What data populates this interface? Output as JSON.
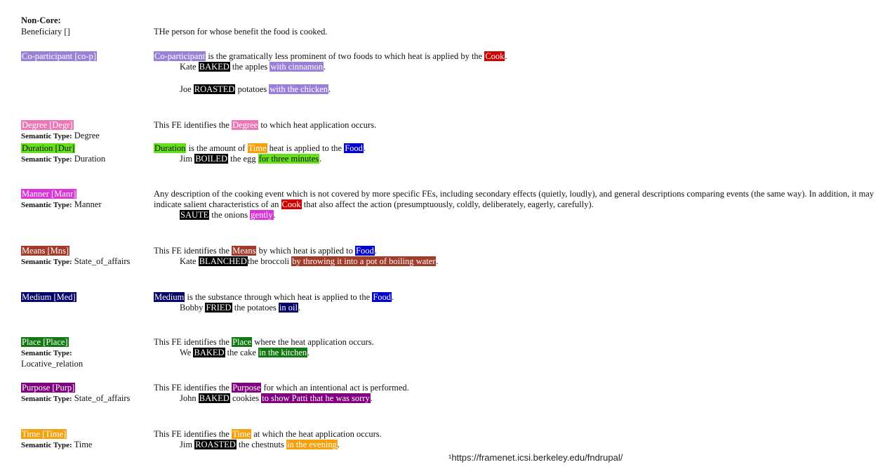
{
  "section_header": "Non-Core:",
  "beneficiary": {
    "name": "Beneficiary []",
    "def": "THe person for whose benefit the food is cooked."
  },
  "semantic_type_label": "Semantic Type:",
  "coparticipant": {
    "name": "Co-participant [co-p]",
    "fe": "Co-participant",
    "def_mid": " is the gramatically less prominent of two foods to which heat is applied by the ",
    "cook": "Cook",
    "end": ".",
    "ex1": {
      "pre": "Kate ",
      "target": "BAKED",
      "mid": " the apples ",
      "fe": "with cinnamon",
      "post": "."
    },
    "ex2": {
      "pre": "Joe ",
      "target": "ROASTED",
      "mid": " potatoes ",
      "fe": "with the chicken",
      "post": "."
    }
  },
  "degree": {
    "name": "Degree [Degr]",
    "type": "Degree",
    "def_pre": "This FE identifies the ",
    "fe": "Degree",
    "def_post": " to which heat application occurs."
  },
  "duration": {
    "name": "Duration [Dur]",
    "type": "Duration",
    "fe": "Duration",
    "def_mid": " is the amount of ",
    "time": "Time",
    "def_mid2": " heat is applied to the ",
    "food": "Food",
    "end": ".",
    "ex": {
      "pre": "Jim ",
      "target": "BOILED",
      "mid": " the egg ",
      "fe": "for three minutes",
      "post": "."
    }
  },
  "manner": {
    "name": "Manner [Manr]",
    "type": "Manner",
    "def_pre": "Any description of the cooking event which is not covered by more specific FEs, including secondary effects (quietly, loudly), and general descriptions comparing events (the same way). In addition, it may indicate salient characteristics of an ",
    "cook": "Cook",
    "def_post": " that also affect the action (presumptuously, coldly, deliberately, eagerly, carefully).",
    "ex": {
      "target": "SAUTE",
      "mid": " the onions ",
      "fe": "gently",
      "post": "."
    }
  },
  "means": {
    "name": "Means [Mns]",
    "type": "State_of_affairs",
    "def_pre": "This FE identifies the ",
    "fe": "Means",
    "def_mid": " by which heat is applied to ",
    "food": "Food",
    "end": ".",
    "ex": {
      "pre": "Kate ",
      "target": "BLANCHED",
      "mid": "the broccoli ",
      "fe": "by throwing it into a pot of boiling water",
      "post": "."
    }
  },
  "medium": {
    "name": "Medium [Med]",
    "fe": "Medium",
    "def_mid": " is the substance through which heat is applied to the ",
    "food": "Food",
    "end": ".",
    "ex": {
      "pre": "Bobby ",
      "target": "FRIED",
      "mid": " the potatoes ",
      "fe": "in oil",
      "post": "."
    }
  },
  "place": {
    "name": "Place [Place]",
    "type": "Locative_relation",
    "def_pre": "This FE identifies the ",
    "fe": "Place",
    "def_post": " where the heat application occurs.",
    "ex": {
      "pre": "We ",
      "target": "BAKED",
      "mid": " the cake ",
      "fe": "in the kitchen",
      "post": "."
    }
  },
  "purpose": {
    "name": "Purpose [Purp]",
    "type": "State_of_affairs",
    "def_pre": "This FE identifies the ",
    "fe": "Purpose",
    "def_post": " for which an intentional act is performed.",
    "ex": {
      "pre": "John ",
      "target": "BAKED",
      "mid": " cookies ",
      "fe": "to show Patti that he was sorry",
      "post": "."
    }
  },
  "time": {
    "name": "Time [Time]",
    "type": "Time",
    "def_pre": "This FE identifies the ",
    "fe": "Time",
    "def_post": " at which the heat application occurs.",
    "ex": {
      "pre": "Jim ",
      "target": "ROASTED",
      "mid": " the chestnuts ",
      "fe": "in the evening",
      "post": "."
    }
  },
  "footnote": "¹https://framenet.icsi.berkeley.edu/fndrupal/",
  "colors": {
    "co-participant": "#9b7fd9",
    "cook": "#cc0000",
    "target": "#000000",
    "degree": "#ec77b4",
    "duration": "#66e01a",
    "time": "#f5a10e",
    "food": "#0000cc",
    "manner": "#dd33dd",
    "means": "#a33b2a",
    "medium": "#000066",
    "place": "#137a13",
    "purpose": "#800080"
  }
}
